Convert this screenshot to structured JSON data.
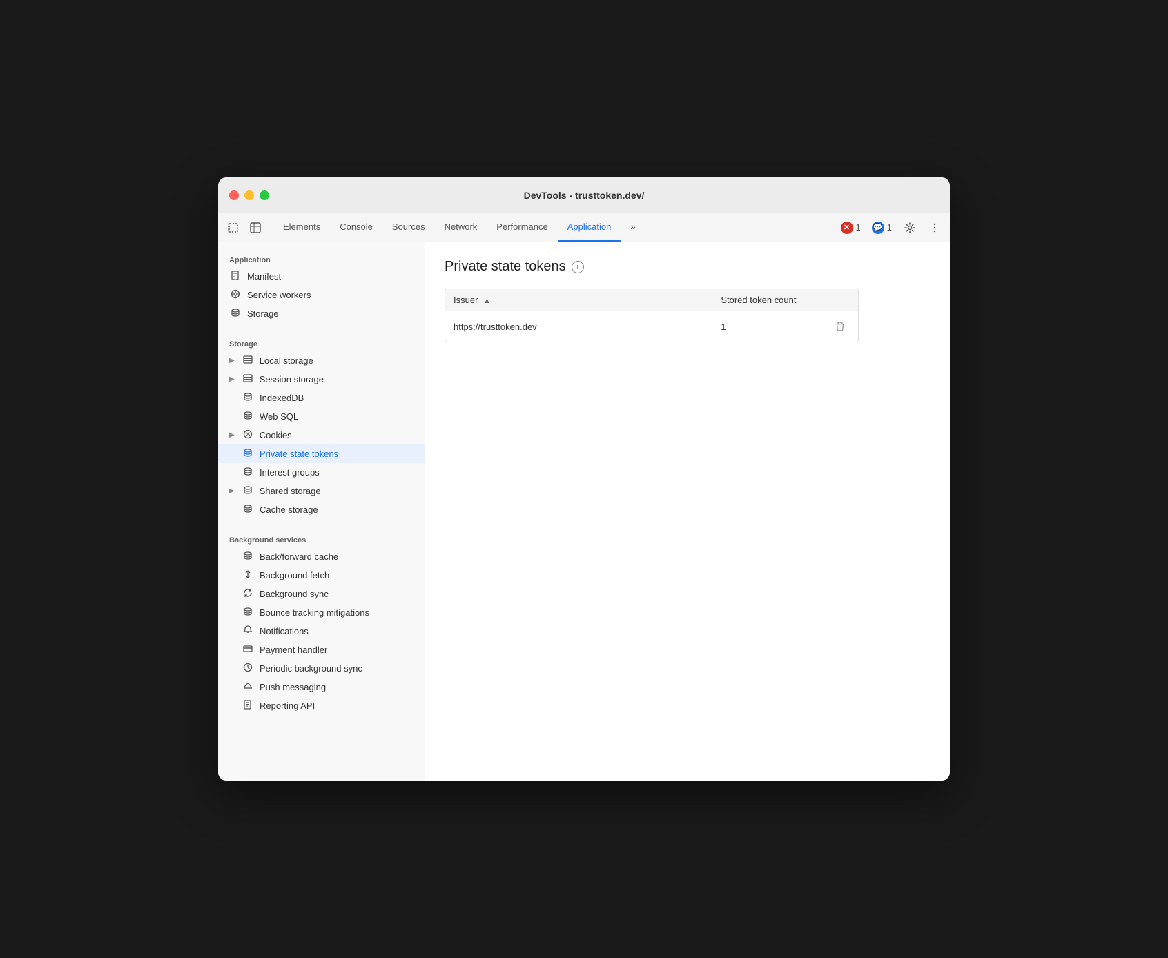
{
  "window": {
    "title": "DevTools - trusttoken.dev/"
  },
  "toolbar": {
    "tabs": [
      {
        "id": "elements",
        "label": "Elements",
        "active": false
      },
      {
        "id": "console",
        "label": "Console",
        "active": false
      },
      {
        "id": "sources",
        "label": "Sources",
        "active": false
      },
      {
        "id": "network",
        "label": "Network",
        "active": false
      },
      {
        "id": "performance",
        "label": "Performance",
        "active": false
      },
      {
        "id": "application",
        "label": "Application",
        "active": true
      },
      {
        "id": "more",
        "label": "»",
        "active": false
      }
    ],
    "errorCount": "1",
    "infoCount": "1"
  },
  "sidebar": {
    "applicationSection": {
      "label": "Application",
      "items": [
        {
          "id": "manifest",
          "label": "Manifest",
          "icon": "📄"
        },
        {
          "id": "service-workers",
          "label": "Service workers",
          "icon": "⚙"
        },
        {
          "id": "storage",
          "label": "Storage",
          "icon": "🗄"
        }
      ]
    },
    "storageSection": {
      "label": "Storage",
      "items": [
        {
          "id": "local-storage",
          "label": "Local storage",
          "icon": "▦",
          "hasArrow": true
        },
        {
          "id": "session-storage",
          "label": "Session storage",
          "icon": "▦",
          "hasArrow": true
        },
        {
          "id": "indexeddb",
          "label": "IndexedDB",
          "icon": "🗄",
          "hasArrow": false
        },
        {
          "id": "web-sql",
          "label": "Web SQL",
          "icon": "🗄",
          "hasArrow": false
        },
        {
          "id": "cookies",
          "label": "Cookies",
          "icon": "🍪",
          "hasArrow": true
        },
        {
          "id": "private-state-tokens",
          "label": "Private state tokens",
          "icon": "🗄",
          "active": true
        },
        {
          "id": "interest-groups",
          "label": "Interest groups",
          "icon": "🗄"
        },
        {
          "id": "shared-storage",
          "label": "Shared storage",
          "icon": "🗄",
          "hasArrow": true
        },
        {
          "id": "cache-storage",
          "label": "Cache storage",
          "icon": "🗄"
        }
      ]
    },
    "backgroundSection": {
      "label": "Background services",
      "items": [
        {
          "id": "back-forward-cache",
          "label": "Back/forward cache",
          "icon": "🗄"
        },
        {
          "id": "background-fetch",
          "label": "Background fetch",
          "icon": "↕"
        },
        {
          "id": "background-sync",
          "label": "Background sync",
          "icon": "↻"
        },
        {
          "id": "bounce-tracking",
          "label": "Bounce tracking mitigations",
          "icon": "🗄"
        },
        {
          "id": "notifications",
          "label": "Notifications",
          "icon": "🔔"
        },
        {
          "id": "payment-handler",
          "label": "Payment handler",
          "icon": "💳"
        },
        {
          "id": "periodic-background-sync",
          "label": "Periodic background sync",
          "icon": "🕐"
        },
        {
          "id": "push-messaging",
          "label": "Push messaging",
          "icon": "☁"
        },
        {
          "id": "reporting-api",
          "label": "Reporting API",
          "icon": "📄"
        }
      ]
    }
  },
  "mainContent": {
    "pageTitle": "Private state tokens",
    "table": {
      "columns": [
        {
          "id": "issuer",
          "label": "Issuer",
          "sortable": true
        },
        {
          "id": "count",
          "label": "Stored token count"
        },
        {
          "id": "action",
          "label": ""
        }
      ],
      "rows": [
        {
          "issuer": "https://trusttoken.dev",
          "count": "1"
        }
      ]
    }
  }
}
